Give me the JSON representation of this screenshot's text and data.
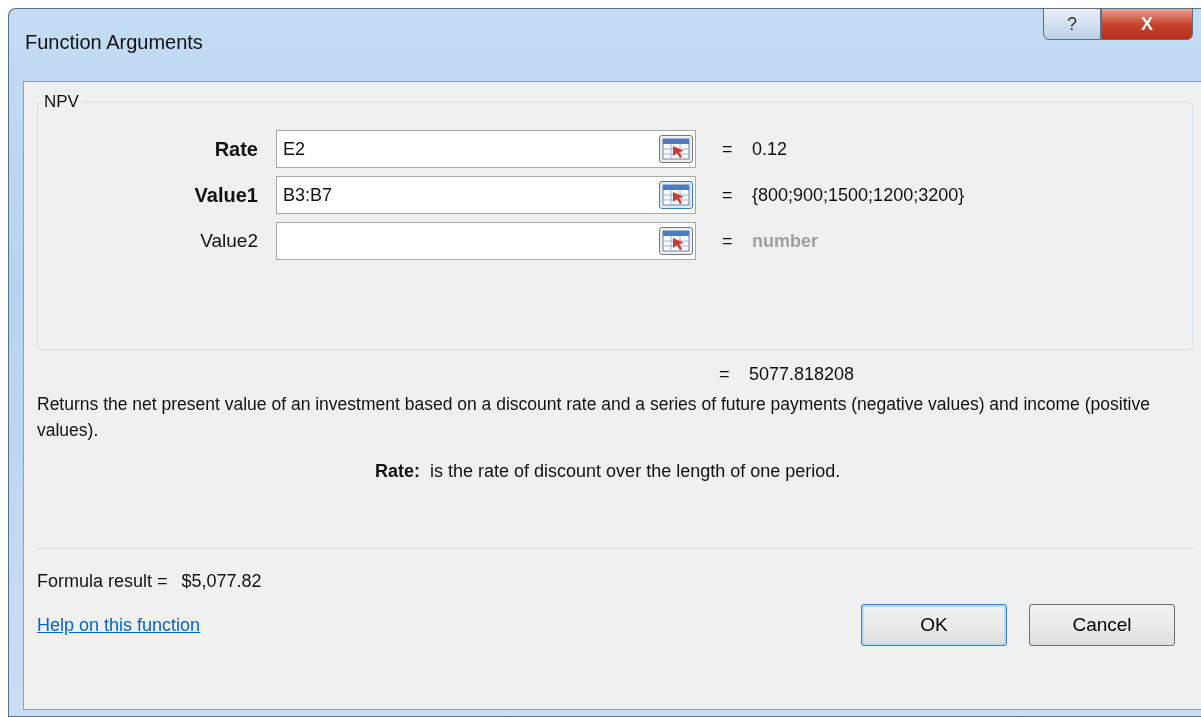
{
  "window": {
    "title": "Function Arguments",
    "buttons": [
      "?",
      "X"
    ]
  },
  "function_name": "NPV",
  "arguments": [
    {
      "label": "Rate",
      "required": true,
      "value": "E2",
      "focused": false,
      "equals": "=",
      "result": "0.12",
      "dimmed": false
    },
    {
      "label": "Value1",
      "required": true,
      "value": "B3:B7",
      "focused": true,
      "equals": "=",
      "result": "{800;900;1500;1200;3200}",
      "dimmed": false
    },
    {
      "label": "Value2",
      "required": false,
      "focused": false,
      "equals": "=",
      "result": "number",
      "dimmed": true
    }
  ],
  "overall_result": {
    "equals": "=",
    "value": "5077.818208"
  },
  "description": "Returns the net present value of an investment based on a discount rate and a series of future payments (negative values) and income (positive values).",
  "argument_help": {
    "label": "Rate:",
    "text": "is the rate of discount over the length of one period."
  },
  "formula_result": {
    "label": "Formula result =",
    "value": "$5,077.82"
  },
  "help_link": "Help on this function",
  "buttons": [
    {
      "label": "OK",
      "default": true
    },
    {
      "label": "Cancel",
      "default": false
    }
  ]
}
